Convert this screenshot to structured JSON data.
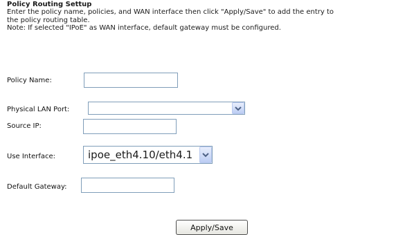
{
  "page": {
    "title": "Policy Routing Settup",
    "intro_line1": "Enter the policy name, policies, and WAN interface then click \"Apply/Save\" to add the entry to",
    "intro_line2": "the policy routing table.",
    "intro_line3": "Note: If selected \"IPoE\" as WAN interface, default gateway must be configured."
  },
  "form": {
    "policy_name_label": "Policy Name:",
    "policy_name_value": "",
    "lan_port_label": "Physical LAN Port:",
    "lan_port_selected": "",
    "source_ip_label": "Source IP:",
    "source_ip_value": "",
    "use_interface_label": "Use Interface:",
    "use_interface_selected": "ipoe_eth4.10/eth4.1",
    "default_gateway_label": "Default Gateway:",
    "default_gateway_value": ""
  },
  "actions": {
    "apply_save_label": "Apply/Save"
  },
  "icons": {
    "dropdown": "chevron-down-icon"
  },
  "colors": {
    "input_border": "#7f9db9",
    "dropdown_button": "#bccdf4",
    "dropdown_arrow": "#4d6185"
  }
}
